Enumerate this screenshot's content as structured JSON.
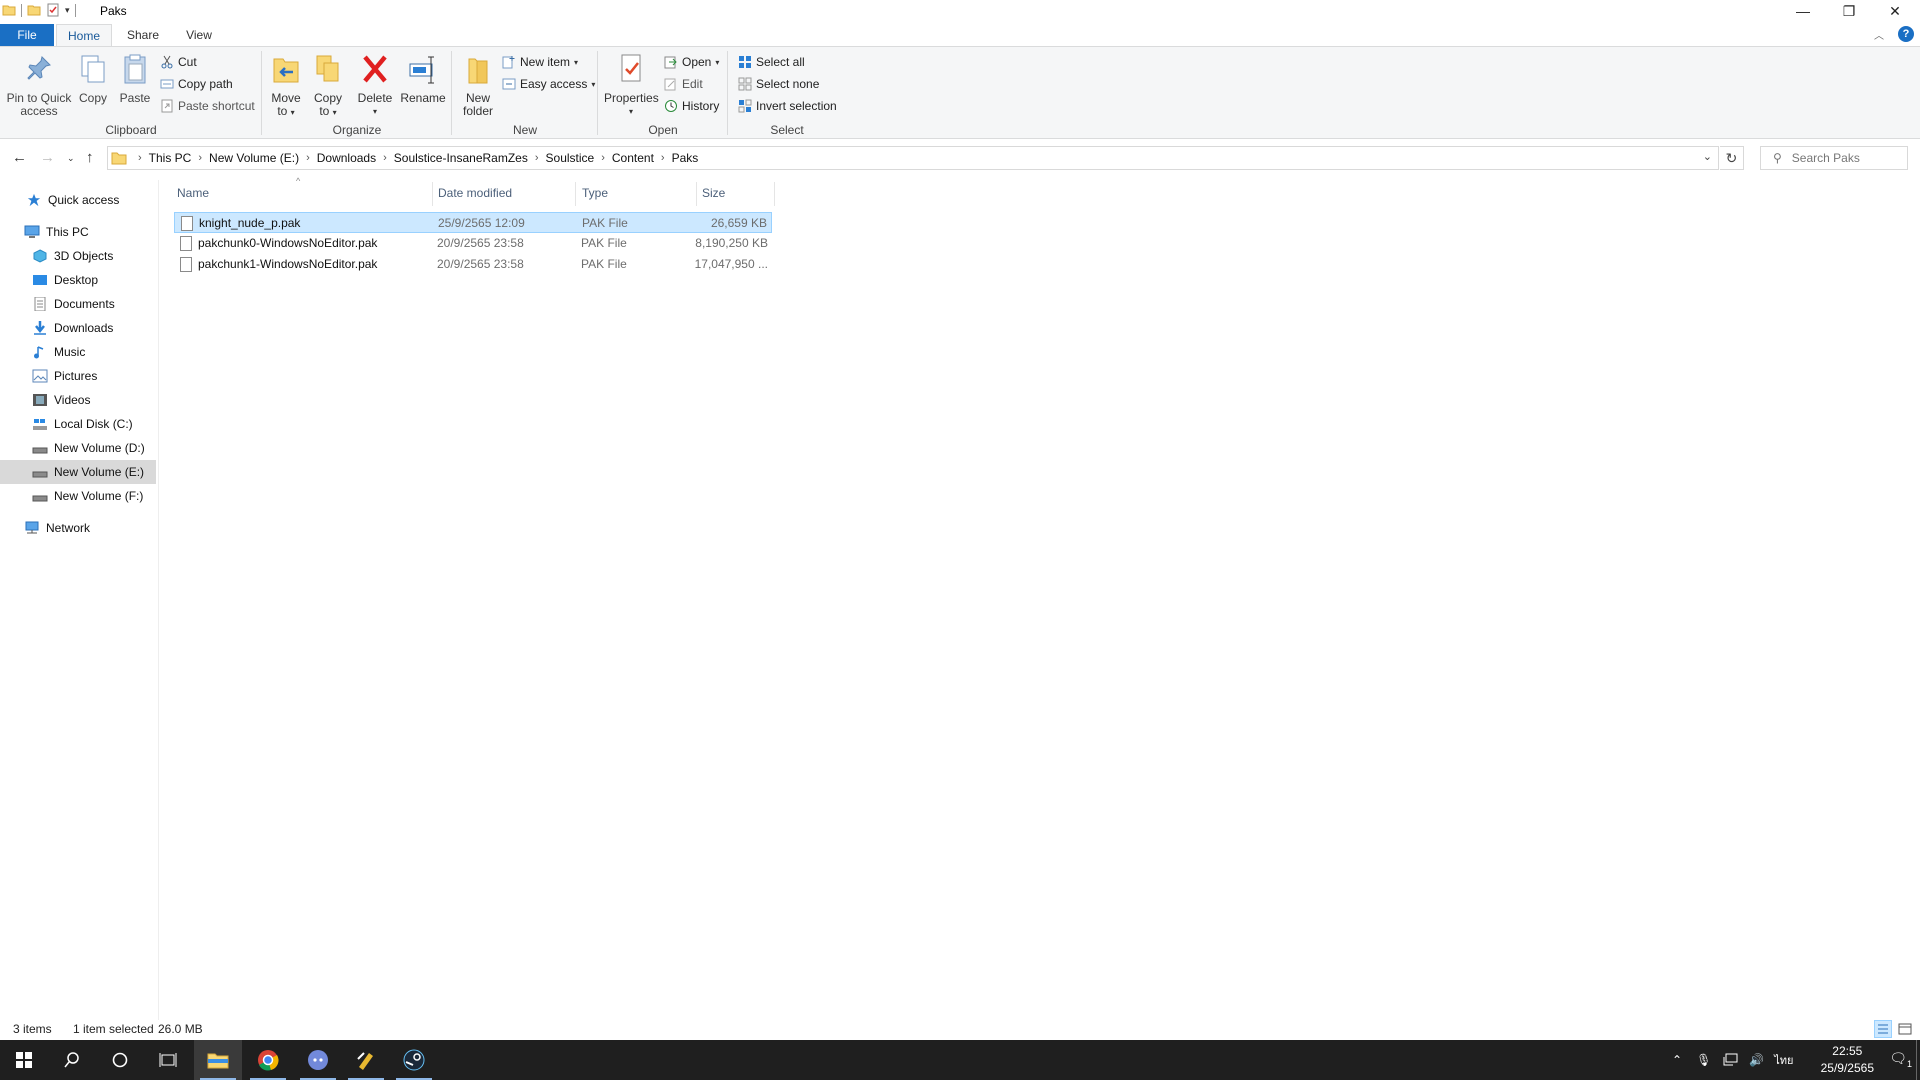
{
  "window": {
    "title": "Paks"
  },
  "ribbon_tabs": {
    "file": "File",
    "home": "Home",
    "share": "Share",
    "view": "View"
  },
  "clipboard": {
    "pin": "Pin to Quick access",
    "pin_l1": "Pin to Quick",
    "pin_l2": "access",
    "copy": "Copy",
    "paste": "Paste",
    "cut": "Cut",
    "copy_path": "Copy path",
    "paste_shortcut": "Paste shortcut",
    "label": "Clipboard"
  },
  "organize": {
    "move_l1": "Move",
    "move_l2": "to",
    "copy_l1": "Copy",
    "copy_l2": "to",
    "delete": "Delete",
    "rename": "Rename",
    "label": "Organize"
  },
  "new_group": {
    "folder_l1": "New",
    "folder_l2": "folder",
    "new_item": "New item",
    "easy_access": "Easy access",
    "label": "New"
  },
  "open_group": {
    "properties": "Properties",
    "open": "Open",
    "edit": "Edit",
    "history": "History",
    "label": "Open"
  },
  "select_group": {
    "select_all": "Select all",
    "select_none": "Select none",
    "invert": "Invert selection",
    "label": "Select"
  },
  "address": {
    "crumbs": [
      "This PC",
      "New Volume (E:)",
      "Downloads",
      "Soulstice-InsaneRamZes",
      "Soulstice",
      "Content",
      "Paks"
    ],
    "search_placeholder": "Search Paks"
  },
  "nav": {
    "quick_access": "Quick access",
    "this_pc": "This PC",
    "objects3d": "3D Objects",
    "desktop": "Desktop",
    "documents": "Documents",
    "downloads": "Downloads",
    "music": "Music",
    "pictures": "Pictures",
    "videos": "Videos",
    "disk_c": "Local Disk (C:)",
    "vol_d": "New Volume (D:)",
    "vol_e": "New Volume (E:)",
    "vol_f": "New Volume (F:)",
    "network": "Network"
  },
  "columns": {
    "name": "Name",
    "date": "Date modified",
    "type": "Type",
    "size": "Size"
  },
  "files": [
    {
      "name": "knight_nude_p.pak",
      "date": "25/9/2565 12:09",
      "type": "PAK File",
      "size": "26,659 KB",
      "selected": true
    },
    {
      "name": "pakchunk0-WindowsNoEditor.pak",
      "date": "20/9/2565 23:58",
      "type": "PAK File",
      "size": "8,190,250 KB",
      "selected": false
    },
    {
      "name": "pakchunk1-WindowsNoEditor.pak",
      "date": "20/9/2565 23:58",
      "type": "PAK File",
      "size": "17,047,950 ...",
      "selected": false
    }
  ],
  "status": {
    "items": "3 items",
    "selected": "1 item selected",
    "size": "26.0 MB"
  },
  "taskbar": {
    "time": "22:55",
    "date": "25/9/2565",
    "lang": "ไทย",
    "notif_count": "1"
  },
  "colors": {
    "accent": "#1a6fc4",
    "selection": "#cce8ff",
    "taskbar": "#1f1f1f"
  }
}
